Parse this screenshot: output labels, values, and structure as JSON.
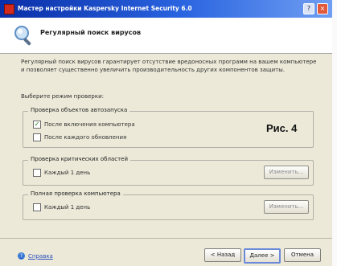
{
  "window": {
    "title": "Мастер настройки Kaspersky Internet Security 6.0",
    "controls": {
      "help": "?",
      "close": "×"
    }
  },
  "header": {
    "title": "Регулярный поиск вирусов"
  },
  "description": "Регулярный поиск вирусов гарантирует отсутствие вредоносных программ на вашем компьютере и позволяет существенно увеличить производительность других компонентов защиты.",
  "select_mode_label": "Выберите режим проверки:",
  "groups": [
    {
      "legend": "Проверка объектов автозапуска",
      "options": [
        {
          "label": "После включения компьютера",
          "checked": true
        },
        {
          "label": "После каждого обновления",
          "checked": false
        }
      ]
    },
    {
      "legend": "Проверка критических областей",
      "options": [
        {
          "label": "Каждый 1 день",
          "checked": false
        }
      ],
      "button": "Изменить..."
    },
    {
      "legend": "Полная проверка компьютера",
      "options": [
        {
          "label": "Каждый 1 день",
          "checked": false
        }
      ],
      "button": "Изменить..."
    }
  ],
  "figure_label": "Рис. 4",
  "footer": {
    "help": "Справка",
    "back": "< Назад",
    "next": "Далее >",
    "cancel": "Отмена"
  },
  "colors": {
    "titlebar": "#0a2fa8",
    "accent": "#2a64e0",
    "link": "#2b4fbf"
  }
}
